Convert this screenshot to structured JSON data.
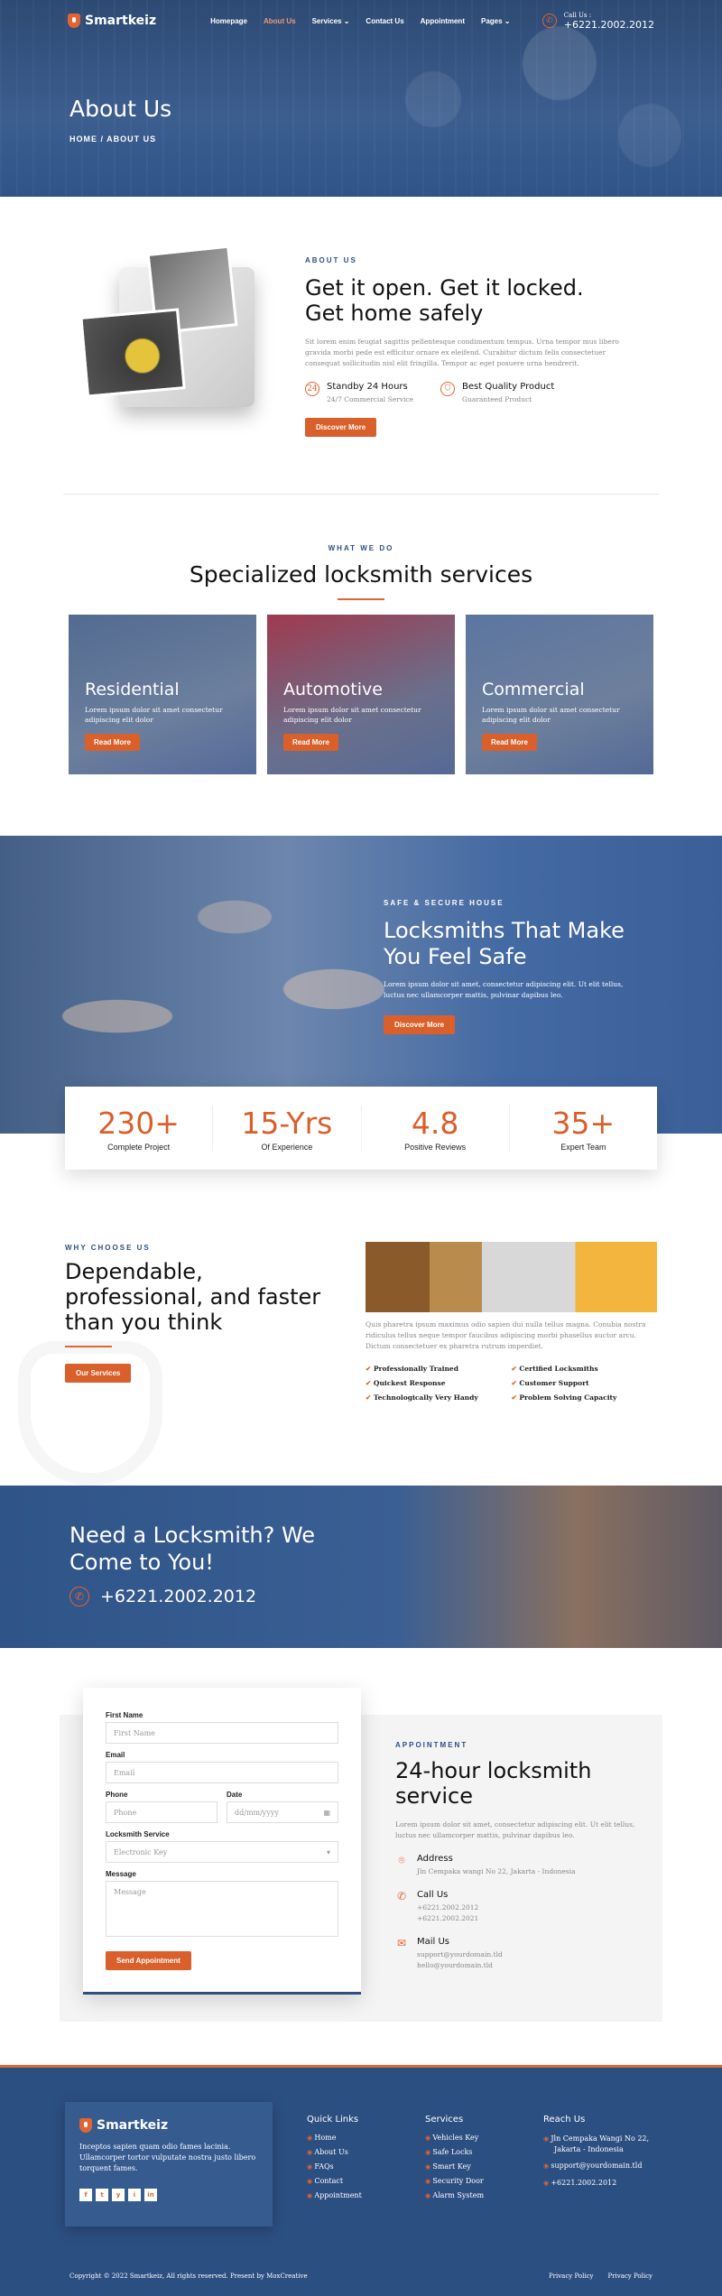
{
  "header": {
    "logo": "Smartkeiz",
    "nav": [
      "Homepage",
      "About Us",
      "Services",
      "Contact Us",
      "Appointment",
      "Pages"
    ],
    "call_label": "Call Us :",
    "call_number": "+6221.2002.2012",
    "title": "About Us",
    "breadcrumb": "HOME  /  ABOUT US"
  },
  "about": {
    "eyebrow": "ABOUT US",
    "title_line1": "Get it open. Get it locked.",
    "title_line2": "Get home safely",
    "text": "Sit lorem enim feugiat sagittis pellentesque condimentum tempus. Urna tempor mus libero gravida morbi pede est efficitur ornare ex eleifend. Curabitur dictum felis consectetuer consequat sollicitudin nisl elit fringilla. Tempor ac eget posuere urna hendrerit.",
    "features": [
      {
        "title": "Standby 24 Hours",
        "sub": "24/7 Commercial Service"
      },
      {
        "title": "Best Quality Product",
        "sub": "Guaranteed Product"
      }
    ],
    "button": "Discover More"
  },
  "services": {
    "eyebrow": "WHAT WE DO",
    "title": "Specialized locksmith services",
    "cards": [
      {
        "title": "Residential",
        "text": "Lorem ipsum dolor sit amet consectetur adipiscing elit dolor",
        "button": "Read More"
      },
      {
        "title": "Automotive",
        "text": "Lorem ipsum dolor sit amet consectetur adipiscing elit dolor",
        "button": "Read More"
      },
      {
        "title": "Commercial",
        "text": "Lorem ipsum dolor sit amet consectetur adipiscing elit dolor",
        "button": "Read More"
      }
    ]
  },
  "family": {
    "eyebrow": "SAFE & SECURE HOUSE",
    "title_line1": "Locksmiths That Make",
    "title_line2": "You Feel Safe",
    "text": "Lorem ipsum dolor sit amet, consectetur adipiscing elit. Ut elit tellus, luctus nec ullamcorper mattis, pulvinar dapibus leo.",
    "button": "Discover More"
  },
  "stats": [
    {
      "value": "230+",
      "label": "Complete Project"
    },
    {
      "value": "15-Yrs",
      "label": "Of Experience"
    },
    {
      "value": "4.8",
      "label": "Positive Reviews"
    },
    {
      "value": "35+",
      "label": "Expert Team"
    }
  ],
  "why": {
    "eyebrow": "WHY CHOOSE US",
    "title_line1": "Dependable,",
    "title_line2": "professional, and faster",
    "title_line3": "than you think",
    "button": "Our Services",
    "text": "Quis pharetra ipsum maximus odio sapien dui nulla tellus magna. Conubia nostra ridiculus tellus neque tempor faucibus adipiscing morbi phasellus auctor arcu. Dictum consectetuer ex pharetra rutrum imperdiet.",
    "checks": [
      "Professionally Trained",
      "Certified Locksmiths",
      "Quickest Response",
      "Customer Support",
      "Technologically Very Handy",
      "Problem Solving Capacity"
    ]
  },
  "need": {
    "title_line1": "Need a Locksmith? We",
    "title_line2": "Come to You!",
    "phone": "+6221.2002.2012"
  },
  "form": {
    "first_name_label": "First Name",
    "first_name_placeholder": "First Name",
    "email_label": "Email",
    "email_placeholder": "Email",
    "phone_label": "Phone",
    "phone_placeholder": "Phone",
    "date_label": "Date",
    "date_placeholder": "dd/mm/yyyy",
    "service_label": "Locksmith Service",
    "service_value": "Electronic Key",
    "message_label": "Message",
    "message_placeholder": "Message",
    "button": "Send Appointment"
  },
  "appointment": {
    "eyebrow": "APPOINTMENT",
    "title_line1": "24-hour locksmith",
    "title_line2": "service",
    "text": "Lorem ipsum dolor sit amet, consectetur adipiscing elit. Ut elit tellus, luctus nec ullamcorper mattis, pulvinar dapibus leo.",
    "address_title": "Address",
    "address": "Jln Cempaka wangi No 22, Jakarta - Indonesia",
    "call_title": "Call Us",
    "call1": "+6221.2002.2012",
    "call2": "+6221.2002.2021",
    "mail_title": "Mail Us",
    "mail1": "support@yourdomain.tld",
    "mail2": "hello@yourdomain.tld"
  },
  "footer": {
    "logo": "Smartkeiz",
    "about": "Inceptos sapien quam odio fames lacinia. Ullamcorper tortor vulputate nostra justo libero torquent fames.",
    "social": [
      "f",
      "t",
      "y",
      "i",
      "in"
    ],
    "quick_title": "Quick Links",
    "quick": [
      "Home",
      "About Us",
      "FAQs",
      "Contact",
      "Appointment"
    ],
    "services_title": "Services",
    "services": [
      "Vehicles Key",
      "Safe Locks",
      "Smart Key",
      "Security Door",
      "Alarm System"
    ],
    "reach_title": "Reach Us",
    "reach_address_1": "Jln Cempaka Wangi No 22,",
    "reach_address_2": "Jakarta - Indonesia",
    "reach_mail": "support@yourdomain.tld",
    "reach_phone": "+6221.2002.2012",
    "copyright": "Copyright © 2022 Smartkeiz, All rights reserved. Present by MoxCreative",
    "bottom_links": [
      "Privacy Policy",
      "Privacy Policy"
    ]
  }
}
